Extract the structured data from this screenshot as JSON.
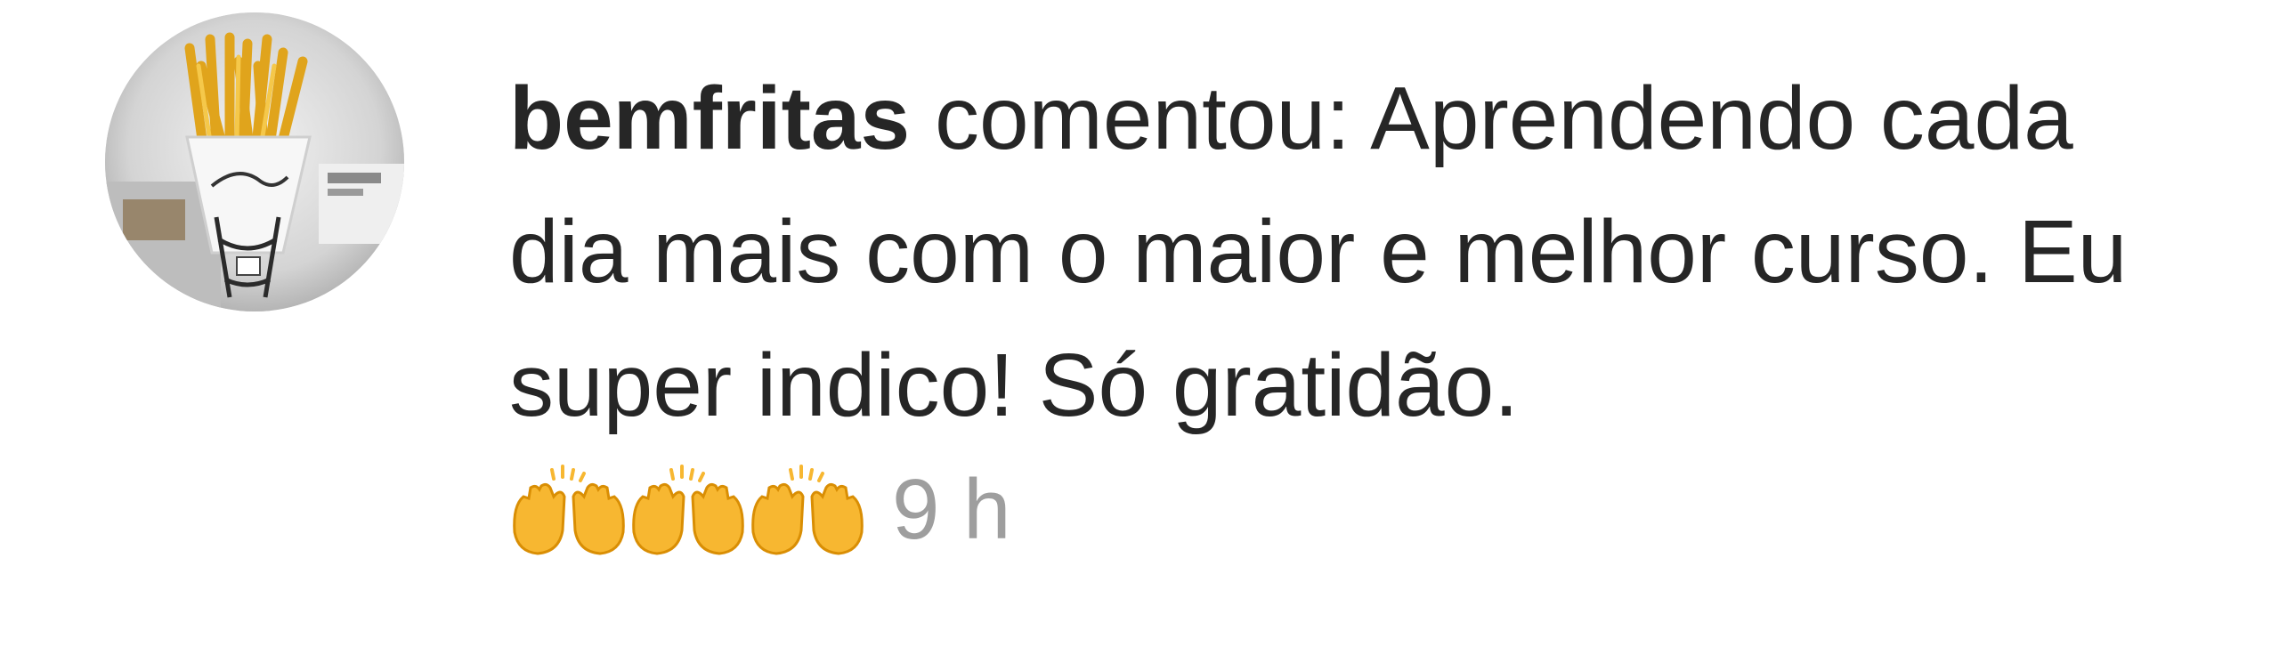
{
  "comment": {
    "username": "bemfritas",
    "verb": " comentou: ",
    "text": "Aprendendo cada dia mais com o maior e melhor curso. Eu super indico! Só gratidão.",
    "emojis": [
      "raising-hands-icon",
      "raising-hands-icon",
      "raising-hands-icon"
    ],
    "timestamp": "9 h"
  },
  "colors": {
    "text": "#262626",
    "timestamp": "#9e9e9e",
    "emoji": "#f7b731"
  }
}
